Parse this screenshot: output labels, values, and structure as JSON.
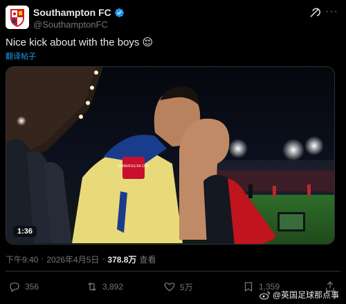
{
  "account": {
    "name": "Southampton FC",
    "handle": "@SouthamptonFC",
    "verified": true,
    "avatar_icon": "southampton-crest-icon"
  },
  "tweet": {
    "text": "Nice kick about with the boys",
    "emoji": "😌",
    "translate_label": "翻译帖子"
  },
  "media": {
    "duration": "1:36",
    "shirt_badge": "EMIRATES FA CUP"
  },
  "meta": {
    "time": "下午9:40",
    "separator": "·",
    "date": "2026年4月5日",
    "views": "378.8万",
    "views_label": "查看"
  },
  "actions": {
    "replies": "356",
    "retweets": "3,892",
    "likes": "5万",
    "bookmarks": "1,359"
  },
  "watermark": {
    "text": "@英国足球那点事",
    "icon": "weibo-icon"
  },
  "colors": {
    "background": "#000000",
    "accent": "#1d9bf0",
    "muted": "#71767b",
    "text": "#e7e9ea"
  }
}
